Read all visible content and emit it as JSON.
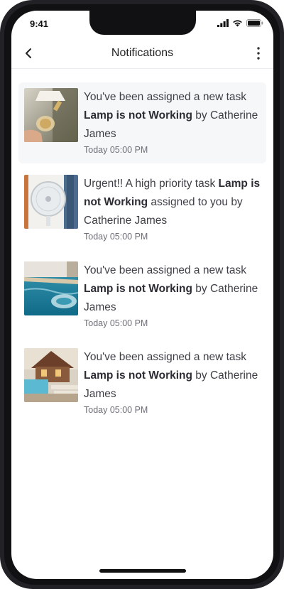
{
  "status_bar": {
    "time": "9:41"
  },
  "header": {
    "title": "Notifications"
  },
  "notifications": [
    {
      "prefix": "You've been assigned a new task ",
      "task": "Lamp is not Working",
      "suffix": " by Catherine James",
      "time": "Today 05:00 PM",
      "highlighted": true,
      "thumbnail": "lamp-bulb-photo"
    },
    {
      "prefix": "Urgent!! A high priority task ",
      "task": "Lamp is not Working",
      "suffix": " assigned to you by Catherine James",
      "time": "Today 05:00 PM",
      "highlighted": false,
      "thumbnail": "fan-photo"
    },
    {
      "prefix": "You've been assigned a new task ",
      "task": "Lamp is not Working",
      "suffix": " by Catherine James",
      "time": "Today 05:00 PM",
      "highlighted": false,
      "thumbnail": "pool-photo"
    },
    {
      "prefix": "You've been assigned a new task ",
      "task": "Lamp is not Working",
      "suffix": " by Catherine James",
      "time": "Today 05:00 PM",
      "highlighted": false,
      "thumbnail": "resort-photo"
    }
  ],
  "colors": {
    "highlight_bg": "#f6f7f9",
    "text": "#3e3e46",
    "muted": "#6e6e78"
  }
}
